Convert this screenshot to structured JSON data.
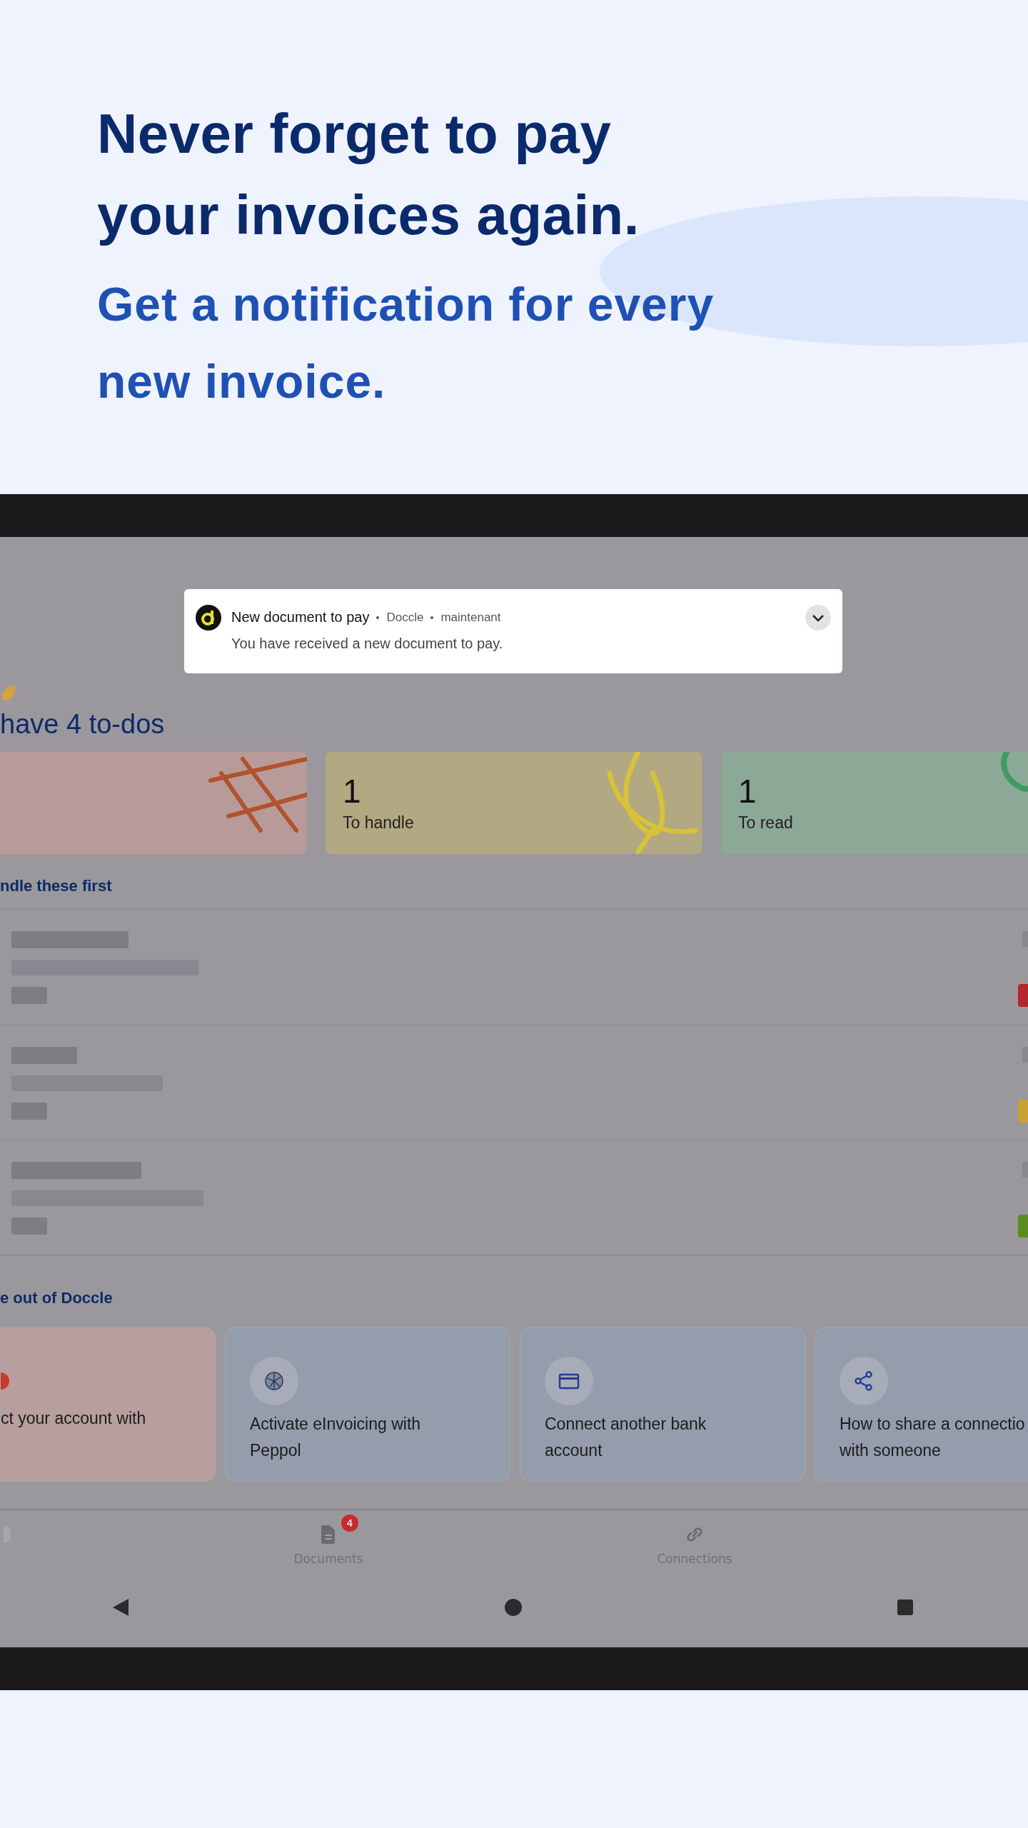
{
  "headline": {
    "lines": [
      "Never forget to pay",
      "your invoices again."
    ],
    "sub_lines": [
      "Get a notification for every",
      "new invoice."
    ]
  },
  "notification": {
    "title": "New document to pay",
    "app": "Doccle",
    "time": "maintenant",
    "body": "You have received a new document to pay."
  },
  "todo_heading": "have 4 to-dos",
  "todo_cards": [
    {
      "kind": "cross",
      "color": "#b89b98"
    },
    {
      "kind": "loop",
      "color": "#b2a881",
      "count": "1",
      "label": "To handle"
    },
    {
      "kind": "curve",
      "color": "#8ca997",
      "count": "1",
      "label": "To read"
    }
  ],
  "first_section": "ndle these first",
  "rows": [
    {
      "color": "#b3262c"
    },
    {
      "color": "#c9a233"
    },
    {
      "color": "#5c8c1f"
    }
  ],
  "tips_section": "e out of Doccle",
  "tips": [
    {
      "kind": "alert",
      "color": "#b89f9e",
      "lines": [
        "ct your account with"
      ]
    },
    {
      "kind": "globe",
      "color": "#959cab",
      "lines": [
        "Activate eInvoicing with",
        "Peppol"
      ]
    },
    {
      "kind": "card",
      "color": "#959cab",
      "lines": [
        "Connect another bank",
        "account"
      ]
    },
    {
      "kind": "share",
      "color": "#959cab",
      "lines": [
        "How to share a connectio",
        "with someone"
      ]
    }
  ],
  "nav": [
    {
      "kind": "partial"
    },
    {
      "kind": "document",
      "label": "Documents",
      "badge": "4"
    },
    {
      "kind": "link",
      "label": "Connections"
    }
  ]
}
